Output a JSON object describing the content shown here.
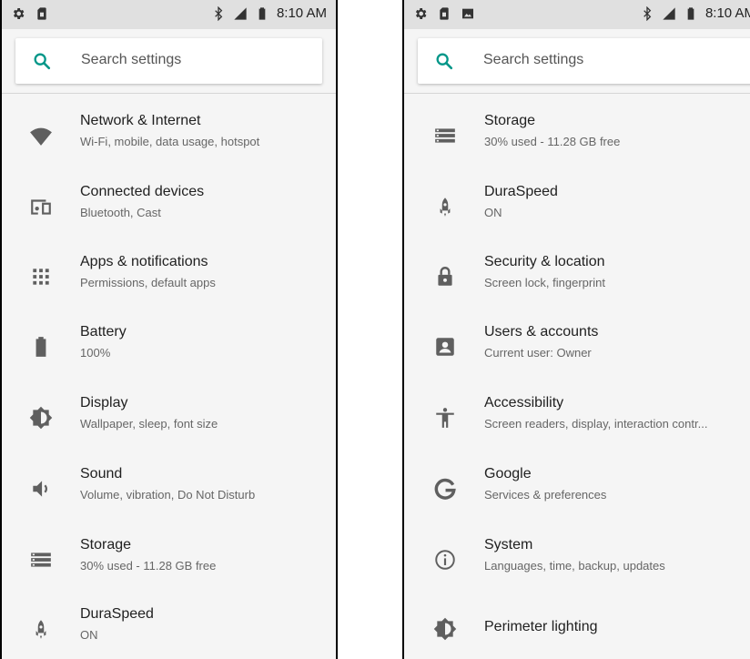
{
  "status_bar": {
    "time": "8:10 AM"
  },
  "search": {
    "placeholder": "Search settings"
  },
  "colors": {
    "accent": "#009688",
    "icon": "#5f5f5f",
    "background": "#f5f5f5",
    "statusbar": "#e0e0e0"
  },
  "left_screen": {
    "items": [
      {
        "title": "Network & Internet",
        "subtitle": "Wi-Fi, mobile, data usage, hotspot",
        "icon": "wifi-icon"
      },
      {
        "title": "Connected devices",
        "subtitle": "Bluetooth, Cast",
        "icon": "devices-icon"
      },
      {
        "title": "Apps & notifications",
        "subtitle": "Permissions, default apps",
        "icon": "apps-grid-icon"
      },
      {
        "title": "Battery",
        "subtitle": "100%",
        "icon": "battery-icon"
      },
      {
        "title": "Display",
        "subtitle": "Wallpaper, sleep, font size",
        "icon": "brightness-icon"
      },
      {
        "title": "Sound",
        "subtitle": "Volume, vibration, Do Not Disturb",
        "icon": "volume-icon"
      },
      {
        "title": "Storage",
        "subtitle": "30% used - 11.28 GB free",
        "icon": "storage-icon"
      },
      {
        "title": "DuraSpeed",
        "subtitle": "ON",
        "icon": "rocket-icon"
      }
    ]
  },
  "right_screen": {
    "items": [
      {
        "title": "Storage",
        "subtitle": "30% used - 11.28 GB free",
        "icon": "storage-icon"
      },
      {
        "title": "DuraSpeed",
        "subtitle": "ON",
        "icon": "rocket-icon"
      },
      {
        "title": "Security & location",
        "subtitle": "Screen lock, fingerprint",
        "icon": "lock-icon"
      },
      {
        "title": "Users & accounts",
        "subtitle": "Current user: Owner",
        "icon": "account-box-icon"
      },
      {
        "title": "Accessibility",
        "subtitle": "Screen readers, display, interaction contr...",
        "icon": "accessibility-icon"
      },
      {
        "title": "Google",
        "subtitle": "Services & preferences",
        "icon": "google-icon"
      },
      {
        "title": "System",
        "subtitle": "Languages, time, backup, updates",
        "icon": "info-icon"
      },
      {
        "title": "Perimeter lighting",
        "icon": "brightness-icon"
      }
    ]
  }
}
